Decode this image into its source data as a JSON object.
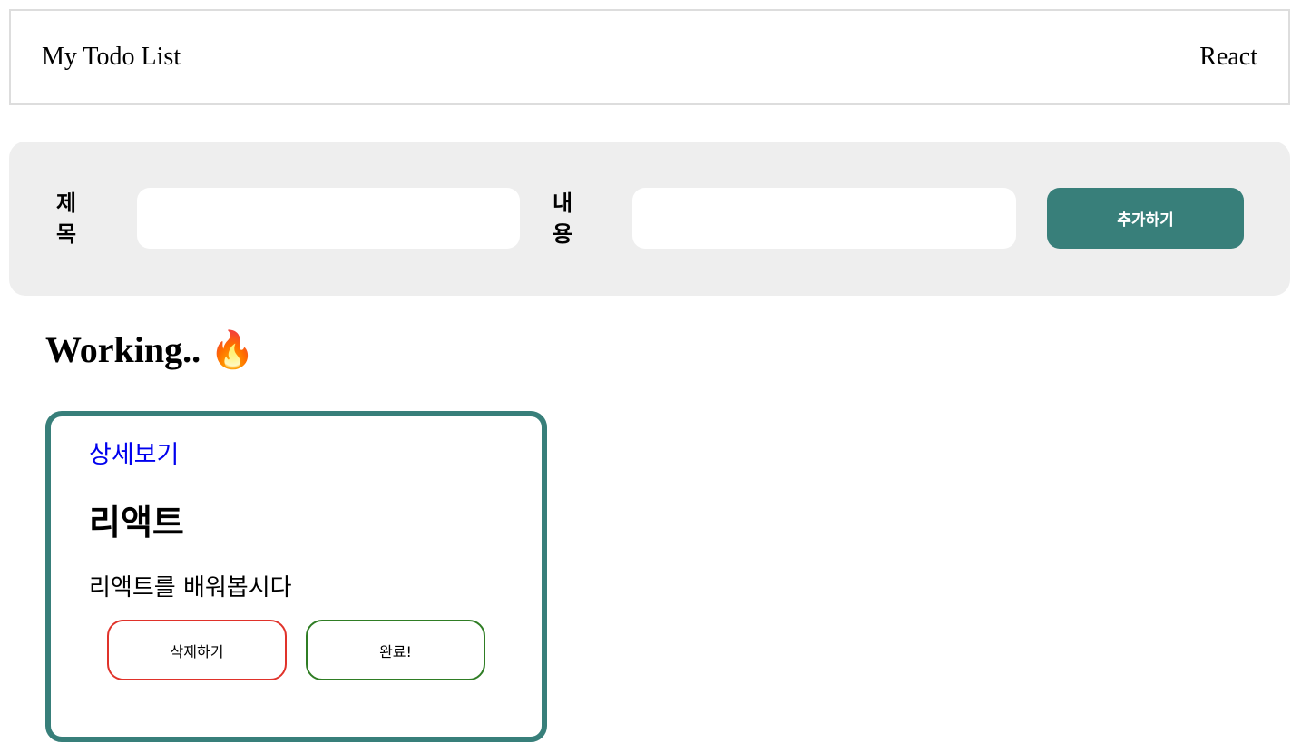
{
  "header": {
    "title": "My Todo List",
    "right_text": "React"
  },
  "form": {
    "title_label": "제목",
    "title_value": "",
    "content_label": "내용",
    "content_value": "",
    "add_button": "추가하기"
  },
  "working": {
    "heading": "Working.. 🔥",
    "todos": [
      {
        "detail_link": "상세보기",
        "title": "리액트",
        "body": "리액트를 배워봅시다",
        "delete_button": "삭제하기",
        "done_button": "완료!"
      }
    ]
  },
  "colors": {
    "accent": "#387f7a",
    "delete_border": "#e0322a",
    "done_border": "#2f7d24",
    "link": "#0000ee",
    "form_background": "#eeeeee"
  }
}
